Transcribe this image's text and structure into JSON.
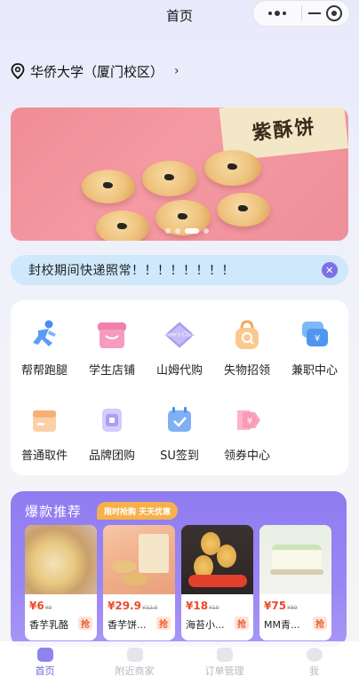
{
  "header": {
    "title": "首页"
  },
  "location": {
    "text": "华侨大学（厦门校区）",
    "icon": "location-pin-icon"
  },
  "banner": {
    "box_text": "紫酥饼",
    "slides": 4,
    "active_slide": 3
  },
  "notice": {
    "text": "封校期间快递照常！！！！！！！！"
  },
  "services": [
    {
      "label": "帮帮跑腿",
      "icon": "running-person-icon"
    },
    {
      "label": "学生店铺",
      "icon": "shop-icon"
    },
    {
      "label": "山姆代购",
      "icon": "sams-club-icon",
      "icon_text": "Sam's Club"
    },
    {
      "label": "失物招领",
      "icon": "lost-found-bag-icon"
    },
    {
      "label": "兼职中心",
      "icon": "part-time-wallet-icon"
    },
    {
      "label": "普通取件",
      "icon": "package-box-icon"
    },
    {
      "label": "品牌团购",
      "icon": "group-buy-icon"
    },
    {
      "label": "SU签到",
      "icon": "calendar-checkin-icon"
    },
    {
      "label": "领券中心",
      "icon": "coupon-icon"
    }
  ],
  "hot": {
    "title": "爆款推荐",
    "tag": "限时抢购 天天优惠",
    "products": [
      {
        "price": "6",
        "original": "9",
        "name": "香芋乳酪",
        "grab": "抢"
      },
      {
        "price": "29.9",
        "original": "32.9",
        "name": "香芋饼...",
        "grab": "抢"
      },
      {
        "price": "18",
        "original": "19",
        "name": "海苔小...",
        "grab": "抢"
      },
      {
        "price": "75",
        "original": "89",
        "name": "MM青...",
        "grab": "抢"
      }
    ]
  },
  "tabbar": [
    {
      "label": "首页",
      "active": true
    },
    {
      "label": "附近商家",
      "active": false
    },
    {
      "label": "订单管理",
      "active": false
    },
    {
      "label": "我",
      "active": false
    }
  ],
  "colors": {
    "accent": "#8f7cf0",
    "notice_bg": "#cfe8fb",
    "price": "#ec4b2b",
    "tag": "#f6b14a"
  }
}
